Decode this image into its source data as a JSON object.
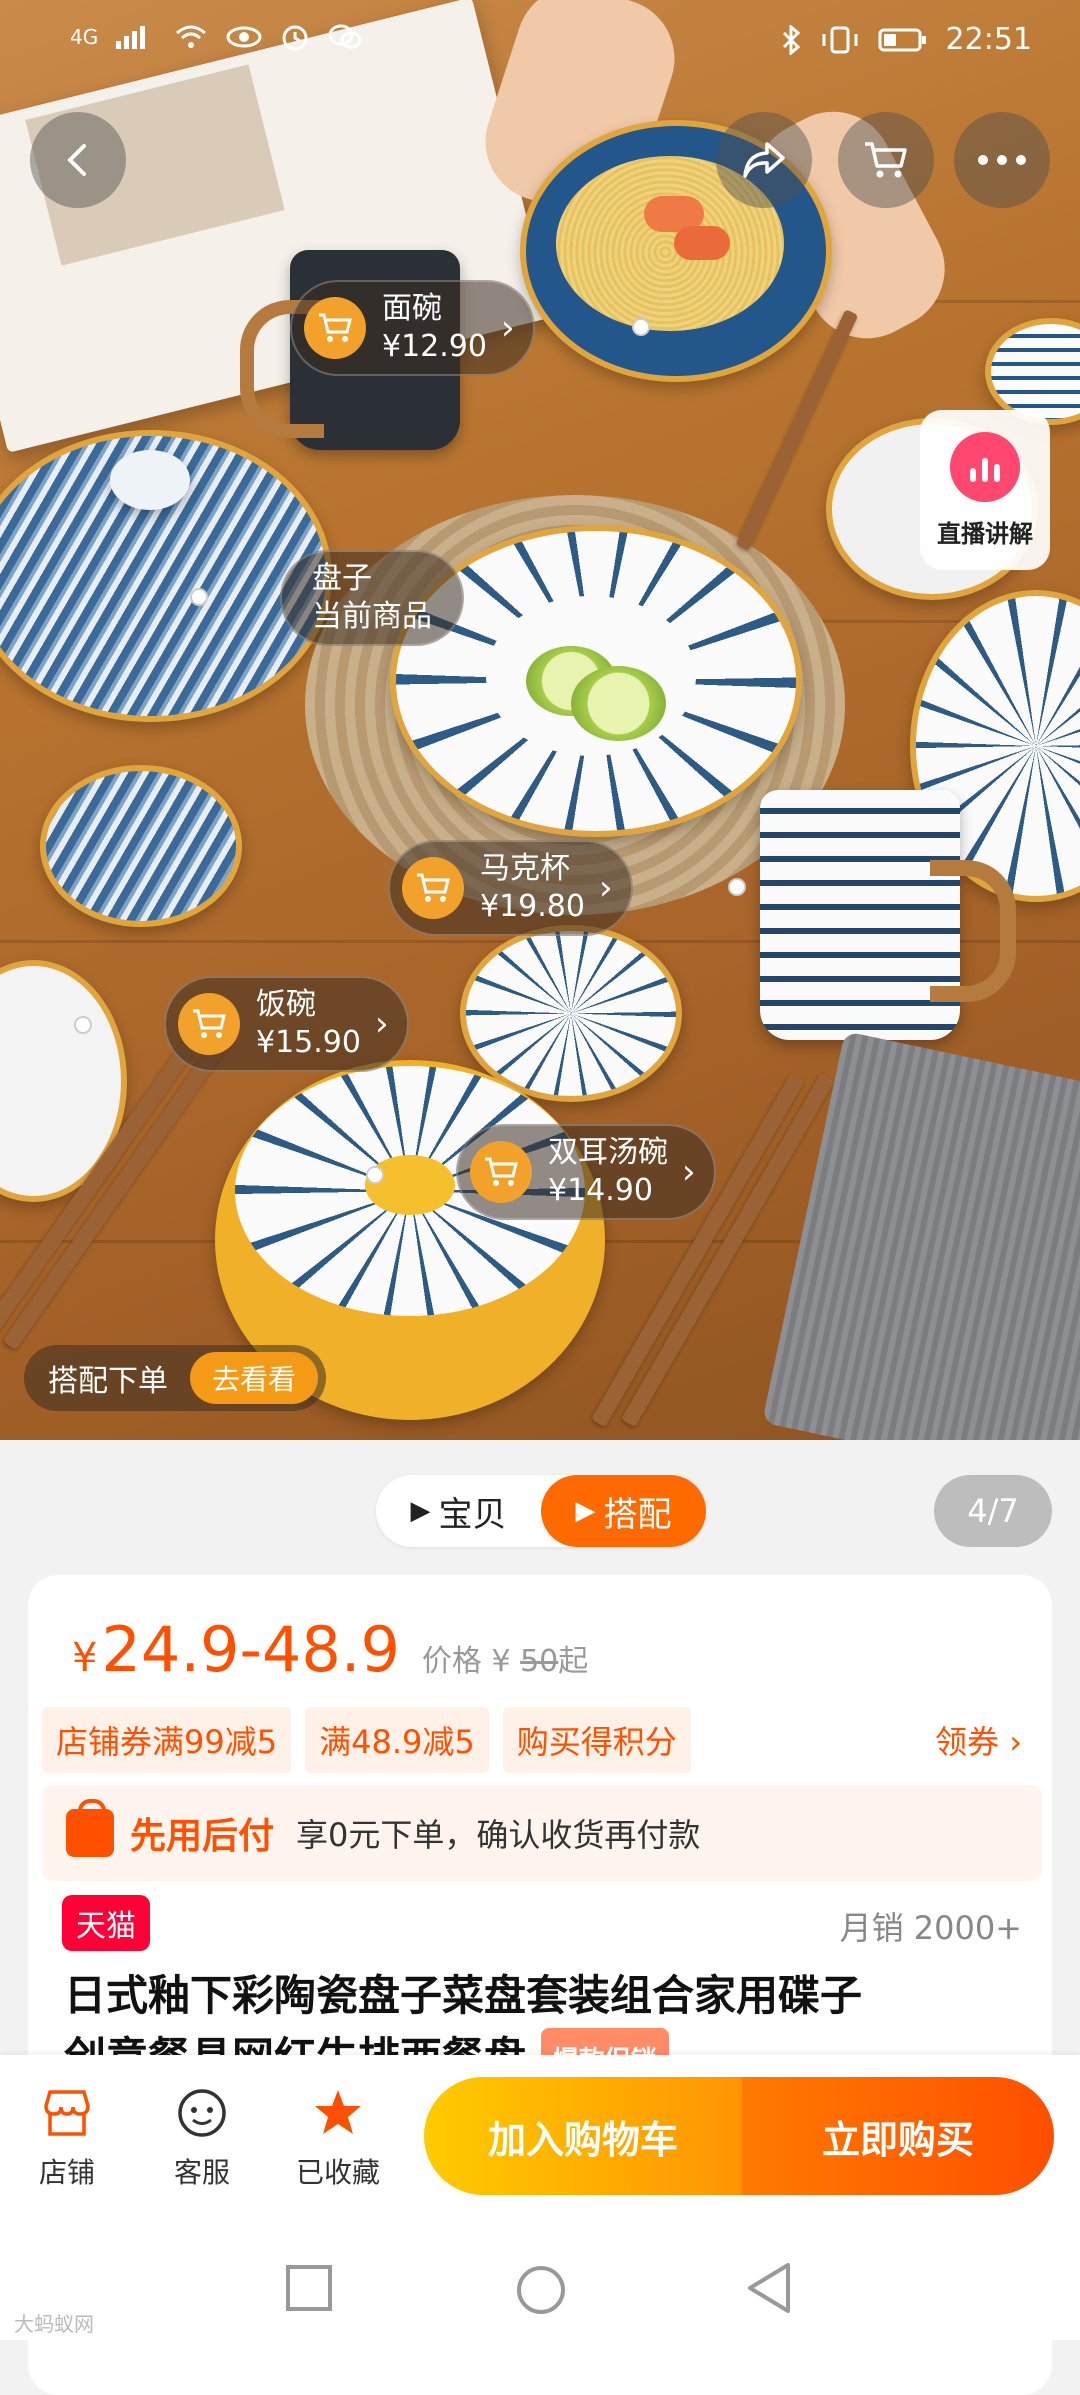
{
  "status_bar": {
    "network": "4G",
    "time": "22:51"
  },
  "top_nav": {
    "back_icon": "chevron-left-icon",
    "share_icon": "share-icon",
    "cart_icon": "cart-icon",
    "more_icon": "more-icon"
  },
  "live": {
    "label": "直播讲解"
  },
  "hotspots": [
    {
      "name": "面碗",
      "price": "¥12.90",
      "has_cart": true
    },
    {
      "name": "盘子",
      "sub": "当前商品",
      "has_cart": false
    },
    {
      "name": "马克杯",
      "price": "¥19.80",
      "has_cart": true
    },
    {
      "name": "饭碗",
      "price": "¥15.90",
      "has_cart": true
    },
    {
      "name": "双耳汤碗",
      "price": "¥14.90",
      "has_cart": true
    }
  ],
  "combo": {
    "label": "搭配下单",
    "button": "去看看"
  },
  "gallery": {
    "tabs": [
      {
        "label": "宝贝",
        "active": false
      },
      {
        "label": "搭配",
        "active": true
      }
    ],
    "counter": "4/7"
  },
  "product": {
    "currency": "¥",
    "price_range": "24.9-48.9",
    "orig_label": "价格 ¥",
    "orig_price": "50",
    "orig_suffix": "起",
    "coupons": [
      "店铺券满99减5",
      "满48.9减5",
      "购买得积分"
    ],
    "get_coupon": "领券",
    "pay_later_title": "先用后付",
    "pay_later_desc": "享0元下单，确认收货再付款",
    "badge": "天猫",
    "monthly_sales": "月销 2000+",
    "title_line1": "日式釉下彩陶瓷盘子菜盘套装组合家用碟子",
    "title_line2": "创意餐具网红牛排西餐盘",
    "hot_tag": "爆款促销"
  },
  "action_bar": {
    "shop": "店铺",
    "service": "客服",
    "favorited": "已收藏",
    "add_to_cart": "加入购物车",
    "buy_now": "立即购买"
  },
  "watermark": "大蚂蚁网",
  "colors": {
    "accent": "#ff5000",
    "tmall": "#ff0036",
    "cart_yellow": "#ffcb00",
    "buy_orange": "#ff4f00",
    "star": "#ff5000"
  }
}
